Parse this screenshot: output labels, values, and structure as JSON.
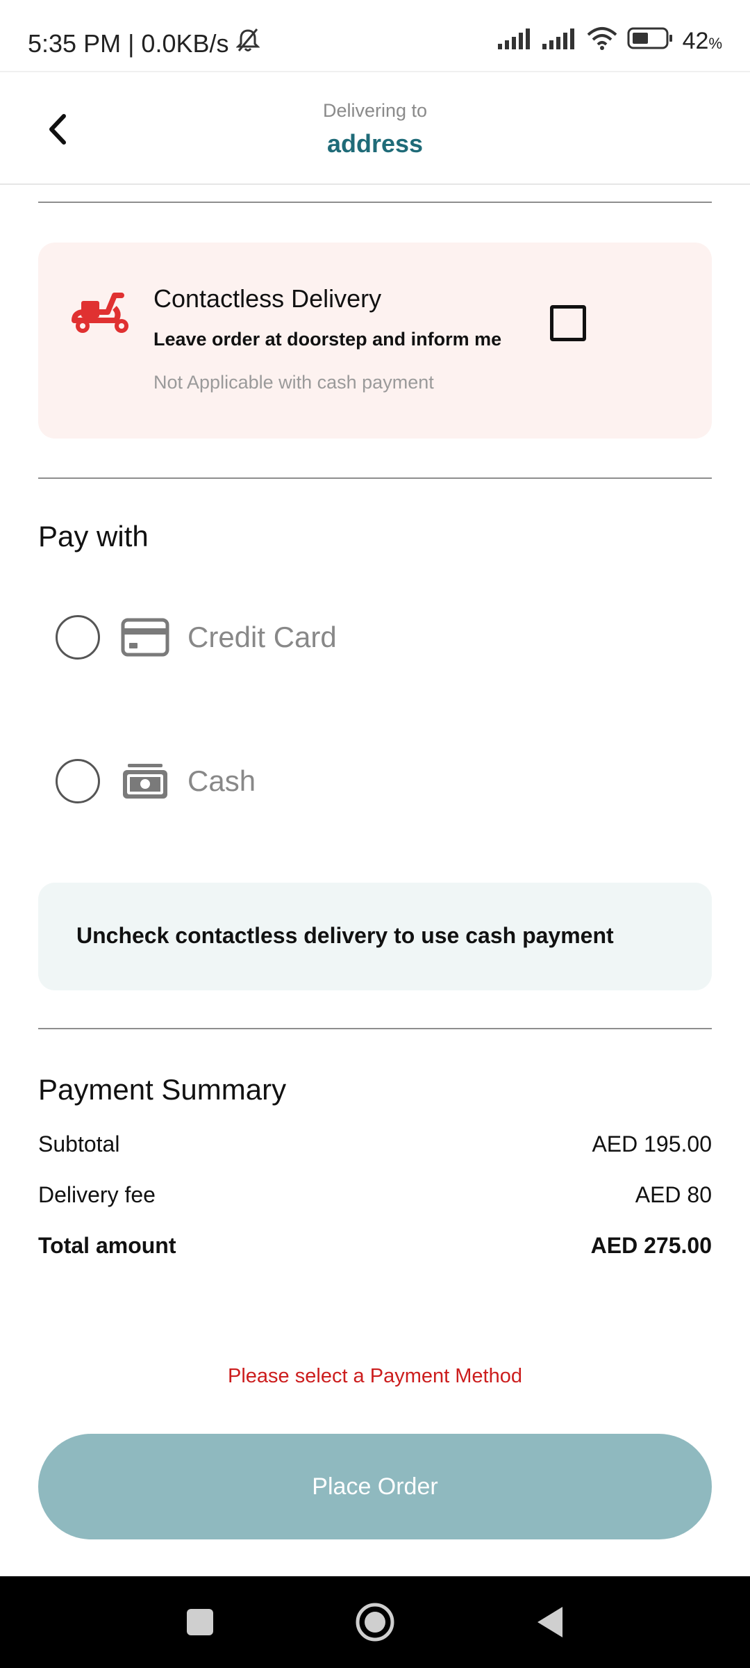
{
  "status_bar": {
    "time_speed": "5:35 PM | 0.0KB/s",
    "battery_percent": "42",
    "battery_sign": "%"
  },
  "header": {
    "subtitle": "Delivering to",
    "title": "address"
  },
  "contactless": {
    "title": "Contactless Delivery",
    "description": "Leave order at doorstep and inform me",
    "note": "Not Applicable with cash payment",
    "checked": false,
    "icon_color": "#e03131"
  },
  "pay_with": {
    "title": "Pay with",
    "options": [
      {
        "label": "Credit Card",
        "icon": "credit-card-icon",
        "selected": false
      },
      {
        "label": "Cash",
        "icon": "cash-icon",
        "selected": false
      }
    ],
    "info": "Uncheck contactless delivery to use cash payment"
  },
  "summary": {
    "title": "Payment Summary",
    "rows": [
      {
        "label": "Subtotal",
        "value": "AED 195.00"
      },
      {
        "label": "Delivery fee",
        "value": "AED 80"
      },
      {
        "label": "Total amount",
        "value": "AED 275.00"
      }
    ]
  },
  "error": "Please select a Payment Method",
  "place_order_label": "Place Order",
  "colors": {
    "accent": "#1f6b78",
    "button_disabled": "#8fb9bf",
    "error": "#cc1d1d",
    "contactless_bg": "#fdf2f0",
    "info_bg": "#f0f6f6"
  }
}
